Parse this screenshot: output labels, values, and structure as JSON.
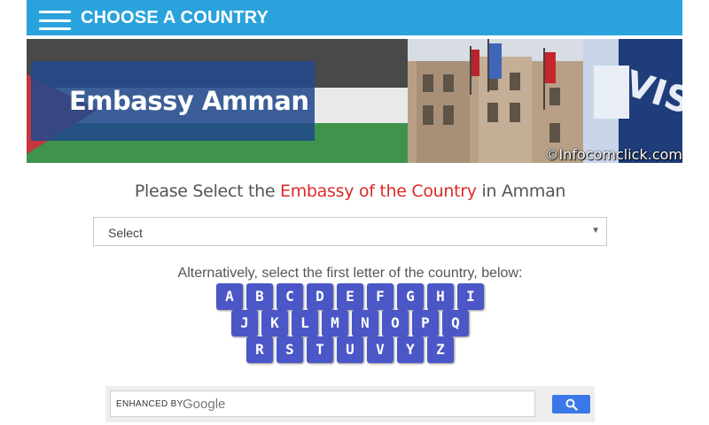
{
  "header": {
    "title": "CHOOSE A COUNTRY",
    "menu_icon": "hamburger-menu-icon"
  },
  "banner": {
    "title": "Embassy Amman",
    "watermark": "©Infocomclick.com"
  },
  "heading": {
    "prefix": "Please Select the ",
    "highlight": "Embassy of the Country",
    "suffix": " in Amman"
  },
  "select": {
    "value": "Select",
    "arrow": "▼"
  },
  "letters": {
    "instruction": "Alternatively, select the first letter of the country, below:",
    "rows": [
      [
        "A",
        "B",
        "C",
        "D",
        "E",
        "F",
        "G",
        "H",
        "I"
      ],
      [
        "J",
        "K",
        "L",
        "M",
        "N",
        "O",
        "P",
        "Q"
      ],
      [
        "R",
        "S",
        "T",
        "U",
        "V",
        "Y",
        "Z"
      ]
    ]
  },
  "search": {
    "label": "ENHANCED BY",
    "brand": "Google",
    "button_icon": "search-icon"
  },
  "colors": {
    "topbar": "#2aa3dc",
    "letter_button": "#4b57c7",
    "highlight": "#dd2a2a",
    "search_button": "#3b78e7"
  }
}
